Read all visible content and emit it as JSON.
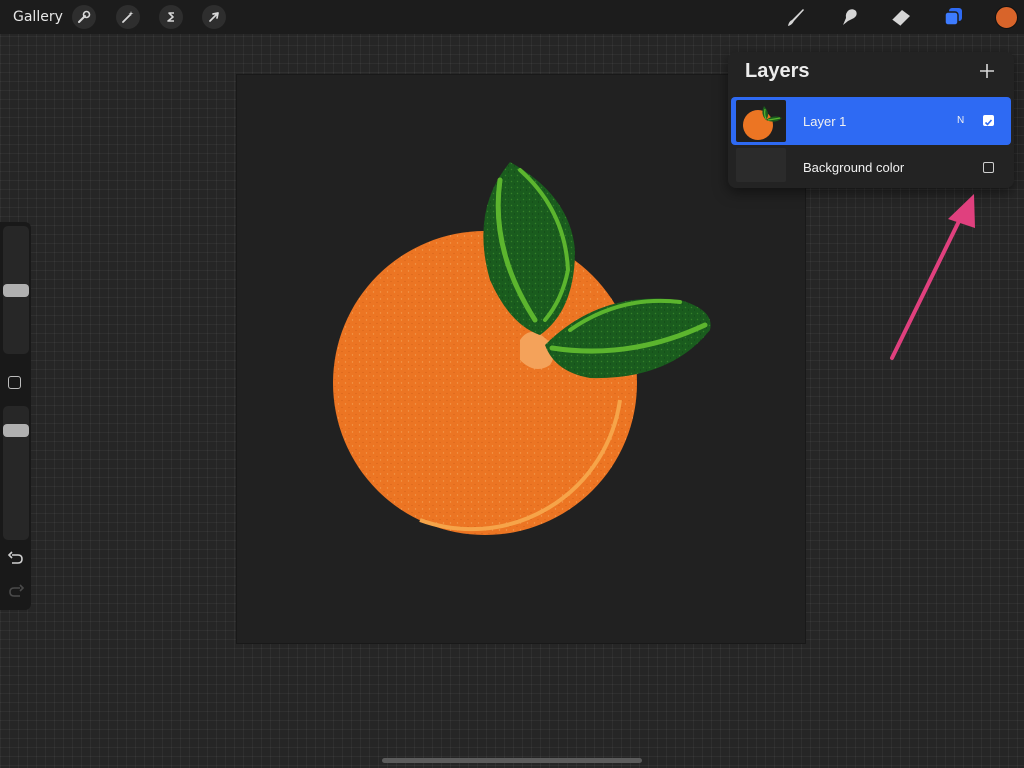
{
  "topbar": {
    "gallery_label": "Gallery",
    "left_tools": [
      {
        "name": "actions",
        "icon": "wrench-icon"
      },
      {
        "name": "adjustments",
        "icon": "magic-wand-icon"
      },
      {
        "name": "selection",
        "icon": "selection-s-icon"
      },
      {
        "name": "transform",
        "icon": "arrow-cursor-icon"
      }
    ],
    "right_tools": [
      {
        "name": "brush",
        "icon": "brush-icon"
      },
      {
        "name": "smudge",
        "icon": "smudge-icon"
      },
      {
        "name": "eraser",
        "icon": "eraser-icon"
      },
      {
        "name": "layers",
        "icon": "layers-icon",
        "active": true
      }
    ],
    "current_color": "#d8642a"
  },
  "layers_panel": {
    "title": "Layers",
    "add_icon": "plus-icon",
    "layers": [
      {
        "name": "Layer 1",
        "blend_mode": "N",
        "visible": true,
        "selected": true
      },
      {
        "name": "Background color",
        "visible": false,
        "selected": false
      }
    ]
  },
  "sidebar": {
    "brush_size_level": 0.5,
    "opacity_level": 0.85,
    "undo_icon": "undo-icon",
    "redo_icon": "redo-icon"
  },
  "colors": {
    "accent": "#2e6af3",
    "annotation_arrow": "#e0407e",
    "orange": "#ec7523",
    "leaf_dark": "#1a5c1e",
    "leaf_light": "#5cb52e"
  }
}
